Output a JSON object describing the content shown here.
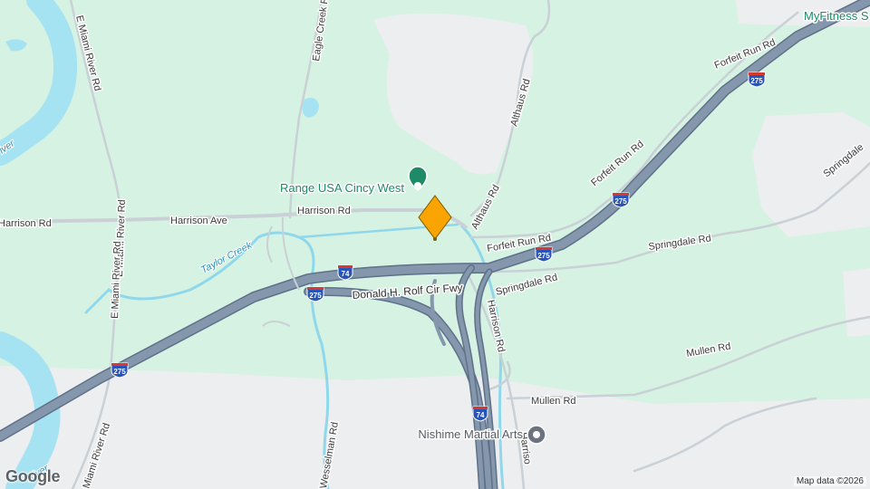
{
  "map": {
    "colors": {
      "land": "#d6f2e2",
      "urban": "#eceef0",
      "water": "#a6e3f2",
      "highway": "#7b8fa6",
      "highway_edge": "#5f7089",
      "road": "#c9d0d6",
      "pin": "#f9a400",
      "poi_green": "#1e8a66",
      "poi_gray": "#6b7380"
    },
    "pin": {
      "name": "dropped-pin",
      "color": "#f9a400"
    },
    "places": [
      {
        "name": "Range USA Cincy West",
        "icon": "range-pin-icon"
      },
      {
        "name": "Nishime Martial Arts",
        "icon": "martial-arts-pin-icon"
      },
      {
        "name": "MyFitness S",
        "icon": ""
      }
    ],
    "roads": {
      "harrison_rd_w": "Harrison Rd",
      "harrison_ave": "Harrison Ave",
      "harrison_rd": "Harrison Rd",
      "harrison_rd_s": "Harrison Rd",
      "harrison_rd_s2": "Harriso",
      "e_miami_river_rd_1": "E Miami River Rd",
      "e_miami_river_rd_2": "E Miami River Rd",
      "e_miami_river_rd_3": "E Miami River Rd",
      "e_miami_river_rd_4": "Miami River Rd",
      "eagle_creek_rd": "Eagle Creek Rd",
      "althaus_rd_1": "Althaus Rd",
      "althaus_rd_2": "Althaus Rd",
      "forfeit_run_rd_1": "Forfeit Run Rd",
      "forfeit_run_rd_2": "Forfeit Run Rd",
      "forfeit_run_rd_3": "Forfeit Run Rd",
      "springdale_rd_1": "Springdale Rd",
      "springdale_rd_2": "Springdale Rd",
      "springdale_rd_3": "Springdale",
      "mullen_rd_1": "Mullen Rd",
      "mullen_rd_2": "Mullen Rd",
      "wesselman_rd": "Wesselman Rd",
      "donald_h_rolf": "Donald H. Rolf Cir Fwy"
    },
    "water_labels": {
      "taylor_creek": "Taylor Creek",
      "river_nw": "iver",
      "river_sw": "River"
    },
    "shields": {
      "i275": "275",
      "i74": "74"
    },
    "attribution": "Map data ©2026",
    "logo": "Google"
  }
}
